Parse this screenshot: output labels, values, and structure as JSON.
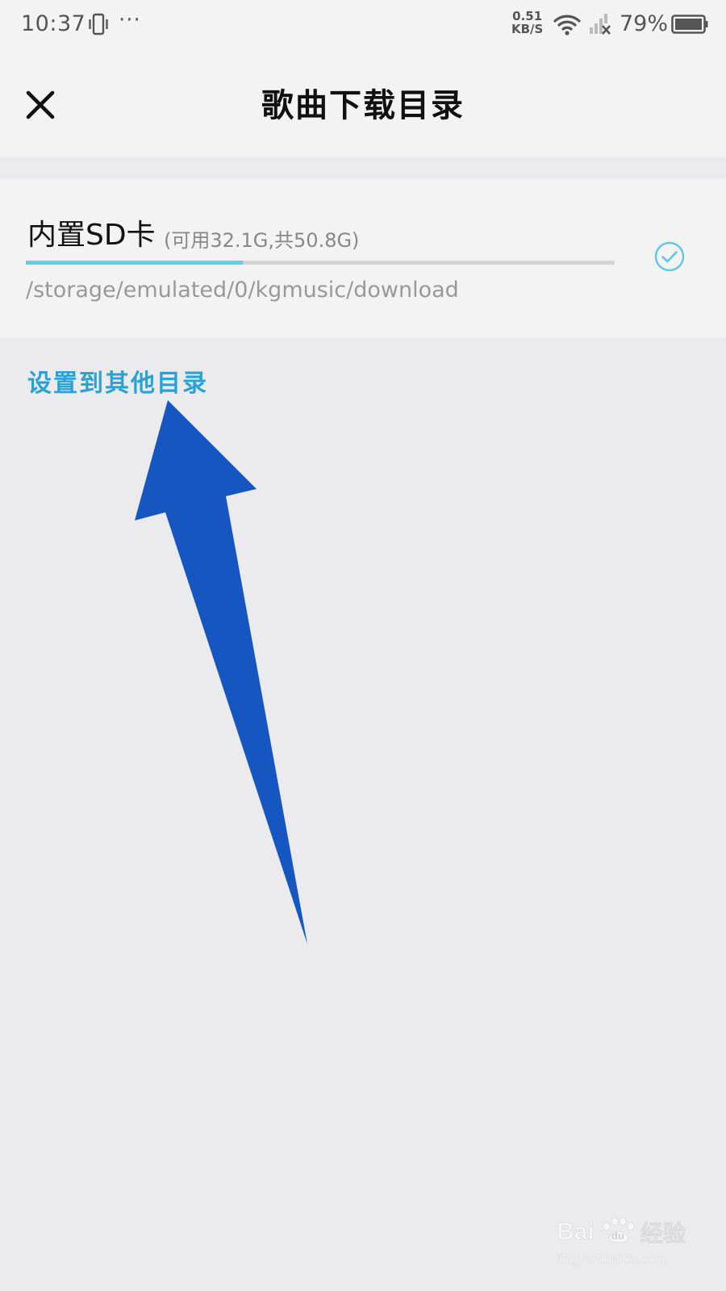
{
  "status_bar": {
    "time": "10:37",
    "more": "···",
    "net_speed_value": "0.51",
    "net_speed_unit": "KB/S",
    "battery_pct": "79%"
  },
  "header": {
    "title": "歌曲下载目录",
    "close_icon": "close-icon"
  },
  "storage": {
    "name": "内置SD卡",
    "capacity": "(可用32.1G,共50.8G)",
    "used_fraction": 0.368,
    "path": "/storage/emulated/0/kgmusic/download",
    "selected": true
  },
  "other_dir_link": "设置到其他目录",
  "watermark": {
    "brand": "Baidu经验",
    "url": "jingyan.baidu.com"
  },
  "colors": {
    "accent": "#29a3d6",
    "progress": "#5fd0ea",
    "arrow": "#1656c0",
    "background": "#ebebed",
    "card": "#f3f3f4"
  }
}
